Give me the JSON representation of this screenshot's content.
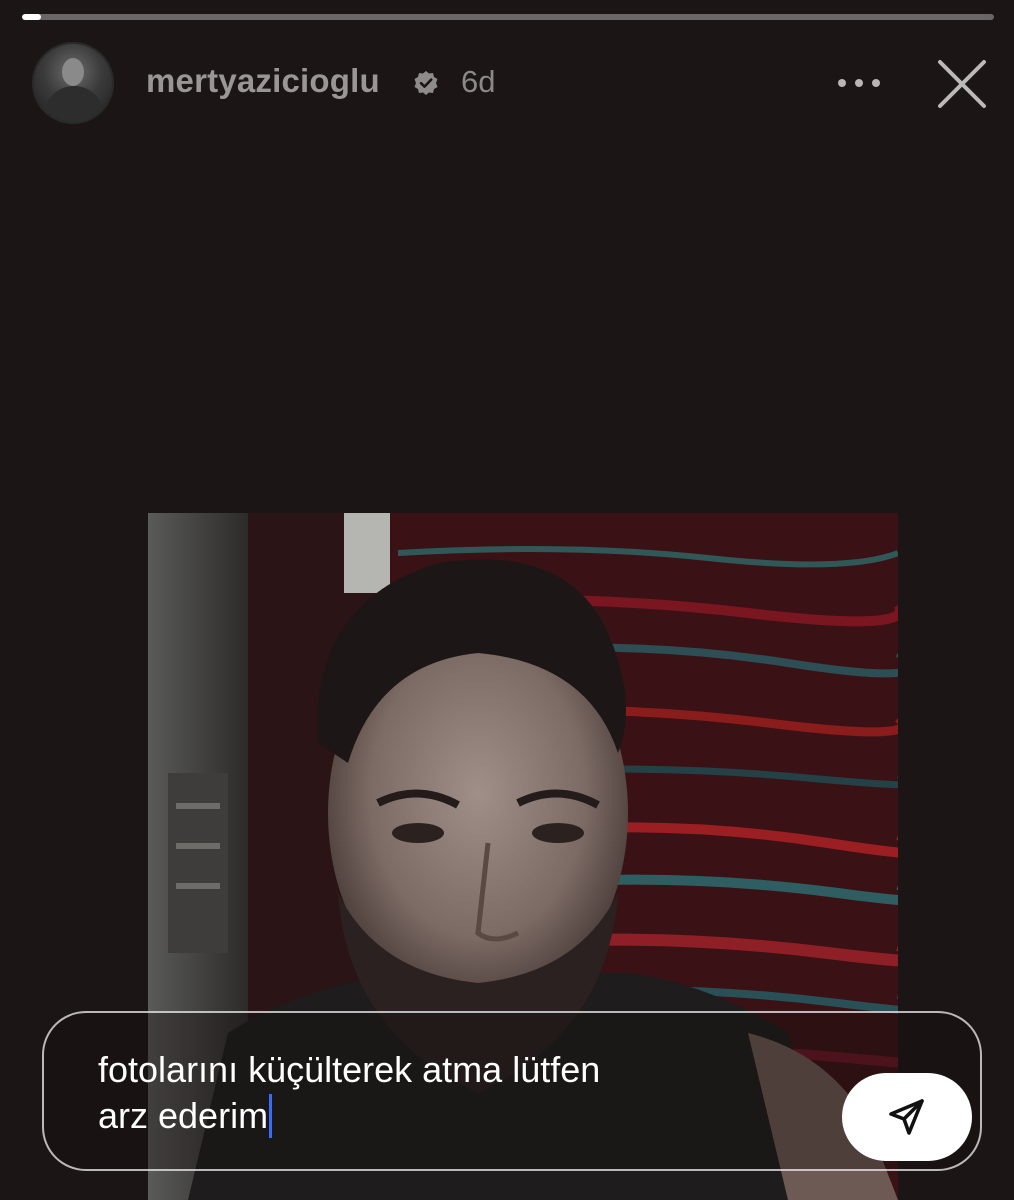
{
  "story": {
    "progress": 0.02
  },
  "header": {
    "username": "mertyazicioglu",
    "time_ago": "6d",
    "verified": true,
    "icons": {
      "verified": "verified-badge-icon",
      "more": "more-options-icon",
      "close": "close-icon"
    }
  },
  "reply": {
    "line1": "fotolarını küçülterek atma lütfen",
    "line2": "arz ederim",
    "send_icon": "send-paper-plane-icon"
  },
  "colors": {
    "background": "#1b1516",
    "caret": "#3b6cf5",
    "send_button": "#ffffff"
  }
}
